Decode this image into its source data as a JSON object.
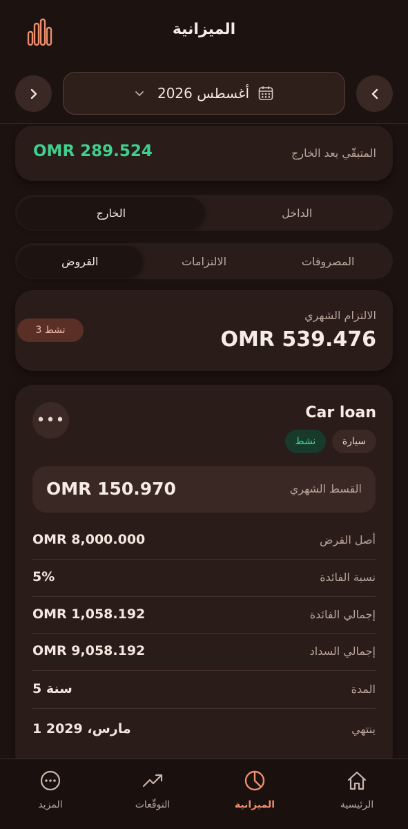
{
  "header": {
    "title": "الميزانية",
    "chart_icon": "bar-chart-icon"
  },
  "month_nav": {
    "month_label": "أغسطس 2026",
    "prev_icon": "chevron-left-icon",
    "next_icon": "chevron-right-icon"
  },
  "remaining": {
    "label": "المتبقّي بعد الخارج",
    "value": "OMR 289.524",
    "color": "#3fcf8e"
  },
  "flow_tabs": {
    "incoming": "الداخل",
    "outgoing": "الخارج",
    "active": "outgoing"
  },
  "category_tabs": {
    "expenses": "المصروفات",
    "commitments": "الالتزامات",
    "loans": "القروض",
    "active": "loans"
  },
  "monthly_commitment": {
    "label": "الالتزام الشهري",
    "value": "OMR 539.476",
    "active_badge": "3 نشط"
  },
  "loan": {
    "name": "Car loan",
    "category_tag": "سيارة",
    "status_tag": "نشط",
    "installment_label": "القسط الشهري",
    "installment_value": "OMR 150.970",
    "details": [
      {
        "label": "أصل القرض",
        "value": "OMR 8,000.000"
      },
      {
        "label": "نسبة الفائدة",
        "value": "5%"
      },
      {
        "label": "إجمالي الفائدة",
        "value": "OMR 1,058.192"
      },
      {
        "label": "إجمالي السداد",
        "value": "OMR 9,058.192"
      },
      {
        "label": "المدة",
        "value": "5 سنة"
      },
      {
        "label": "ينتهي",
        "value": "1 مارس، 2029"
      }
    ]
  },
  "bottom_nav": {
    "home": "الرئيسية",
    "budget": "الميزانية",
    "forecasts": "التوقّعات",
    "more": "المزيد",
    "active": "budget"
  },
  "colors": {
    "accent": "#ee8e6e",
    "positive": "#3fcf8e",
    "background": "#1c1210"
  }
}
